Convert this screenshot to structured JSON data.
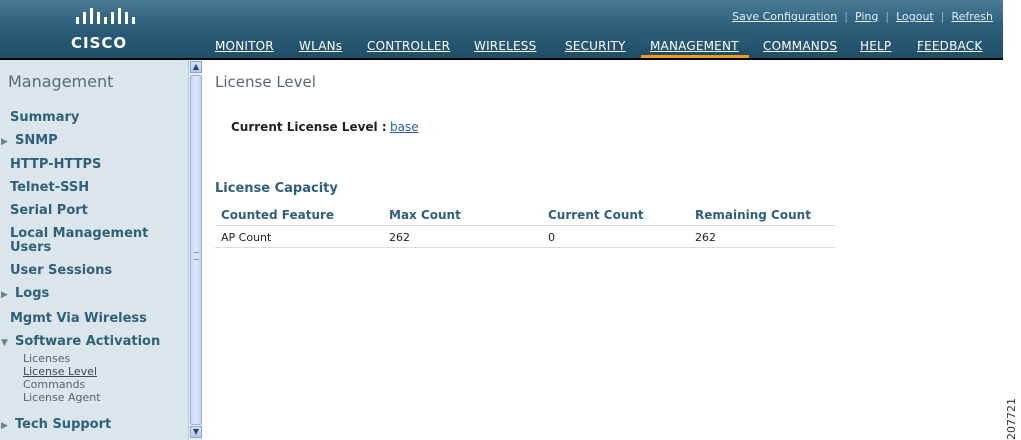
{
  "brand": {
    "name": "CISCO"
  },
  "header": {
    "utility_links": [
      "Save Configuration",
      "Ping",
      "Logout",
      "Refresh"
    ],
    "nav": [
      "MONITOR",
      "WLANs",
      "CONTROLLER",
      "WIRELESS",
      "SECURITY",
      "MANAGEMENT",
      "COMMANDS",
      "HELP",
      "FEEDBACK"
    ],
    "active_nav": "MANAGEMENT"
  },
  "sidebar": {
    "title": "Management",
    "items": [
      {
        "label": "Summary",
        "arrow": ""
      },
      {
        "label": "SNMP",
        "arrow": "▶"
      },
      {
        "label": "HTTP-HTTPS",
        "arrow": ""
      },
      {
        "label": "Telnet-SSH",
        "arrow": ""
      },
      {
        "label": "Serial Port",
        "arrow": ""
      },
      {
        "label": "Local Management",
        "arrow": ""
      },
      {
        "label": "Users",
        "arrow": ""
      },
      {
        "label": "User Sessions",
        "arrow": ""
      },
      {
        "label": "Logs",
        "arrow": "▶"
      },
      {
        "label": "Mgmt Via Wireless",
        "arrow": ""
      },
      {
        "label": "Software Activation",
        "arrow": "▼"
      },
      {
        "label": "Tech Support",
        "arrow": "▶"
      }
    ],
    "sub_items": [
      "Licenses",
      "License Level",
      "Commands",
      "License Agent"
    ],
    "active_sub_item": "License Level"
  },
  "main": {
    "title": "License Level",
    "current_license_label": "Current License Level :",
    "current_license_value": "base",
    "capacity_title": "License Capacity",
    "table": {
      "columns": [
        "Counted Feature",
        "Max Count",
        "Current Count",
        "Remaining Count"
      ],
      "rows": [
        [
          "AP Count",
          "262",
          "0",
          "262"
        ]
      ]
    }
  },
  "figure_number": "207721",
  "colors": {
    "header": "#2f617c",
    "accent": "#f39a1d",
    "sidebar_bg": "#dbe6ec",
    "link": "#2b5f9e"
  }
}
